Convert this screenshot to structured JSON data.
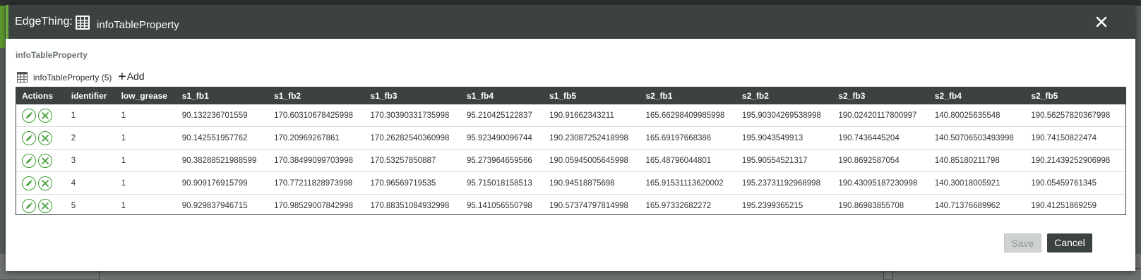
{
  "header": {
    "entity_label": "EdgeThing:",
    "title": "infoTableProperty"
  },
  "property_label": "infoTableProperty",
  "toolbar": {
    "table_name": "infoTableProperty (5)",
    "add_label": "Add"
  },
  "table": {
    "columns": [
      "Actions",
      "identifier",
      "low_grease",
      "s1_fb1",
      "s1_fb2",
      "s1_fb3",
      "s1_fb4",
      "s1_fb5",
      "s2_fb1",
      "s2_fb2",
      "s2_fb3",
      "s2_fb4",
      "s2_fb5"
    ],
    "rows": [
      [
        "1",
        "1",
        "90.132236701559",
        "170.60310678425998",
        "170.30390331735998",
        "95.210425122837",
        "190.91662343211",
        "165.66298409985998",
        "195.90304269538998",
        "190.02420117800997",
        "140.80025635548",
        "190.56257820367998"
      ],
      [
        "2",
        "1",
        "90.142551957762",
        "170.20969267861",
        "170.26282540360998",
        "95.923490096744",
        "190.23087252418998",
        "165.69197668386",
        "195.9043549913",
        "190.7436445204",
        "140.50706503493998",
        "190.74150822474"
      ],
      [
        "3",
        "1",
        "90.38288521988599",
        "170.38499099703998",
        "170.53257850887",
        "95.273964659566",
        "190.05945005645998",
        "165.48796044801",
        "195.90554521317",
        "190.8692587054",
        "140.85180211798",
        "190.21439252906998"
      ],
      [
        "4",
        "1",
        "90.909176915799",
        "170.77211828973998",
        "170.96569719535",
        "95.715018158513",
        "190.94518875698",
        "165.91531113620002",
        "195.23731192968998",
        "190.43095187230998",
        "140.30018005921",
        "190.05459761345"
      ],
      [
        "5",
        "1",
        "90.929837946715",
        "170.98529007842998",
        "170.88351084932998",
        "95.141056550798",
        "190.57374797814998",
        "165.97332682272",
        "195.2399365215",
        "190.86983855708",
        "140.71376689962",
        "190.41251869259"
      ]
    ]
  },
  "footer": {
    "save_label": "Save",
    "cancel_label": "Cancel"
  },
  "colors": {
    "header_bg": "#3b4241",
    "accent_green": "#3a9a2e"
  },
  "icons": {
    "entity_icon": "table-grid-icon",
    "close_icon": "close-icon",
    "row_edit_icon": "pencil-icon",
    "row_delete_icon": "circle-x-icon"
  }
}
